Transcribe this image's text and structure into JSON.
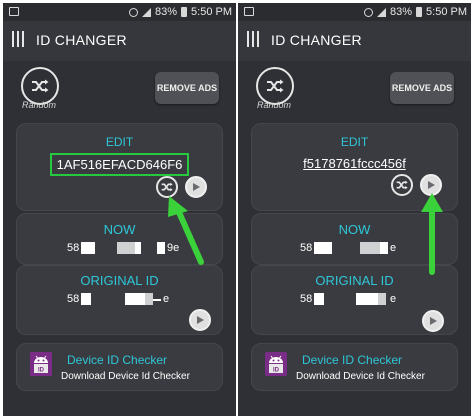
{
  "screens": [
    {
      "status": {
        "battery": "83%",
        "time": "5:50 PM"
      },
      "app_title": "ID CHANGER",
      "random_label": "Random",
      "remove_ads_label": "REMOVE ADS",
      "edit": {
        "title": "EDIT",
        "value": "1AF516EFACD646F6"
      },
      "now": {
        "title": "NOW",
        "prefix": "58",
        "suffix": "9e"
      },
      "original": {
        "title": "ORIGINAL ID",
        "prefix": "58",
        "suffix": "e"
      },
      "checker": {
        "title": "Device ID Checker",
        "subtitle": "Download Device Id Checker"
      }
    },
    {
      "status": {
        "battery": "83%",
        "time": "5:50 PM"
      },
      "app_title": "ID CHANGER",
      "random_label": "Random",
      "remove_ads_label": "REMOVE ADS",
      "edit": {
        "title": "EDIT",
        "value": "f5178761fccc456f"
      },
      "now": {
        "title": "NOW",
        "prefix": "58",
        "suffix": "e"
      },
      "original": {
        "title": "ORIGINAL ID",
        "prefix": "58",
        "suffix": "e"
      },
      "checker": {
        "title": "Device ID Checker",
        "subtitle": "Download Device Id Checker"
      }
    }
  ],
  "colors": {
    "accent_teal": "#2ec7d8",
    "highlight_green": "#27c93f",
    "app_background": "#2f3035",
    "checker_icon": "#7a2d86"
  }
}
